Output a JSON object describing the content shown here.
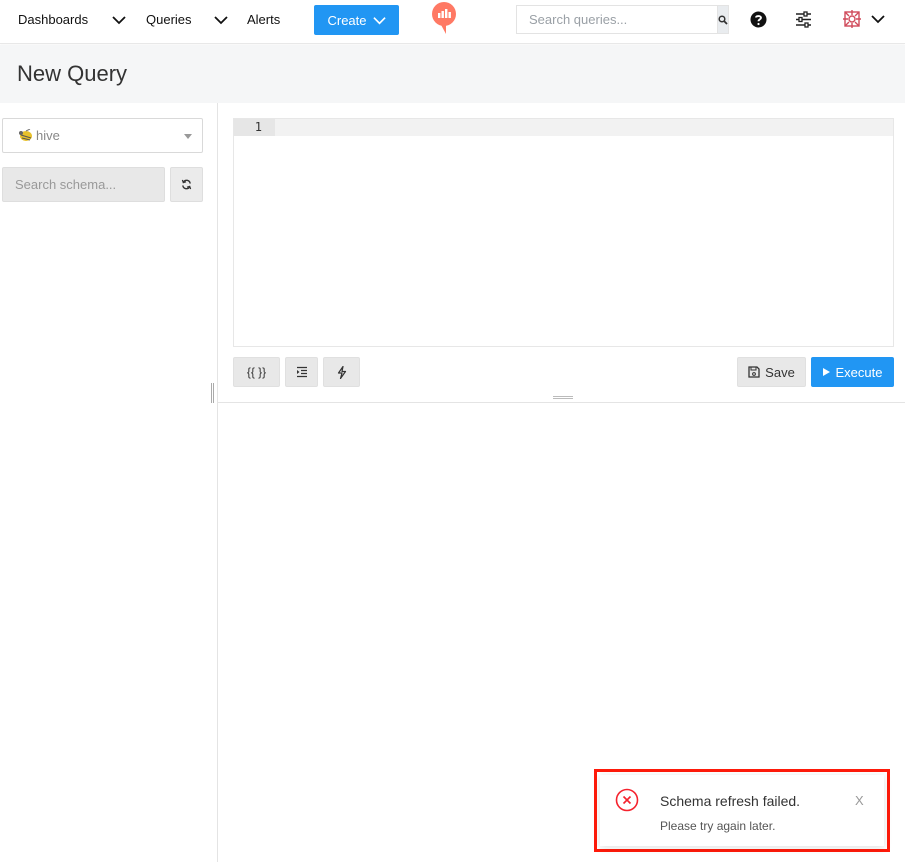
{
  "nav": {
    "dashboards": "Dashboards",
    "queries": "Queries",
    "alerts": "Alerts",
    "create": "Create",
    "search_placeholder": "Search queries..."
  },
  "page": {
    "title": "New Query"
  },
  "sidebar": {
    "datasource": "hive",
    "schema_search_placeholder": "Search schema..."
  },
  "editor": {
    "line_number": "1"
  },
  "toolbar": {
    "params_label": "{{ }}",
    "save_label": "Save",
    "execute_label": "Execute"
  },
  "notification": {
    "title": "Schema refresh failed.",
    "description": "Please try again later.",
    "close": "X"
  },
  "colors": {
    "accent": "#2196f3",
    "logo": "#ff7964",
    "error": "#f5222d",
    "highlight_frame": "#ff1a0a"
  },
  "icons": [
    "chevron-down-icon",
    "redash-logo-icon",
    "search-icon",
    "help-icon",
    "settings-sliders-icon",
    "avatar-icon",
    "hive-icon",
    "refresh-icon",
    "indent-icon",
    "lightning-icon",
    "save-icon",
    "play-icon",
    "error-circle-icon",
    "close-icon"
  ]
}
